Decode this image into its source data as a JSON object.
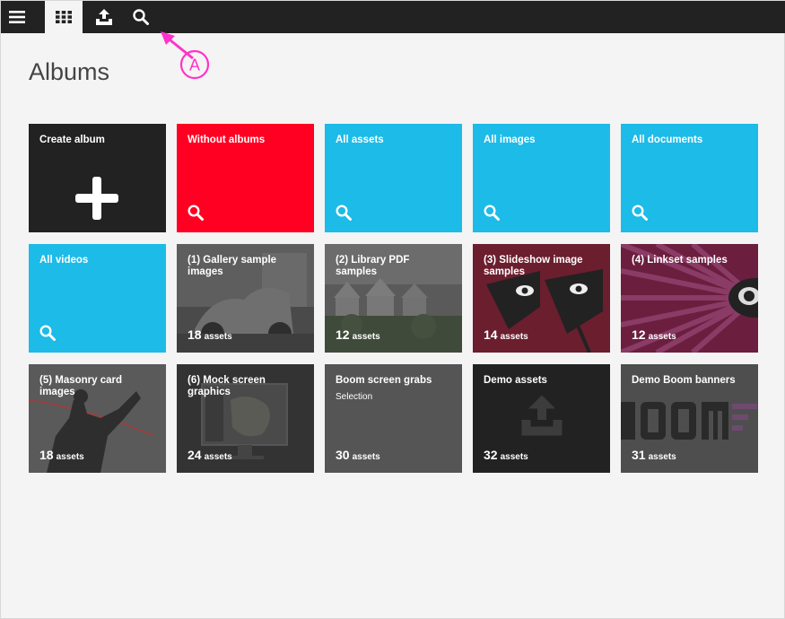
{
  "colors": {
    "topbar": "#222222",
    "dark_tile": "#222222",
    "red_tile": "#ff0022",
    "blue_tile": "#1dbbe8",
    "grey_tile": "#555555",
    "annotation": "#ff33cc"
  },
  "toolbar": {
    "menu_icon": "hamburger-icon",
    "grid_icon": "grid-icon",
    "upload_icon": "upload-icon",
    "search_icon": "search-icon"
  },
  "page": {
    "title": "Albums"
  },
  "annotation": {
    "label": "A"
  },
  "tiles": [
    {
      "title": "Create album"
    },
    {
      "title": "Without albums"
    },
    {
      "title": "All assets"
    },
    {
      "title": "All images"
    },
    {
      "title": "All documents"
    },
    {
      "title": "All videos"
    },
    {
      "title": "(1) Gallery sample images",
      "count": "18",
      "unit": "assets"
    },
    {
      "title": "(2) Library PDF samples",
      "count": "12",
      "unit": "assets"
    },
    {
      "title": "(3) Slideshow image samples",
      "count": "14",
      "unit": "assets"
    },
    {
      "title": "(4) Linkset samples",
      "count": "12",
      "unit": "assets"
    },
    {
      "title": "(5) Masonry card images",
      "count": "18",
      "unit": "assets"
    },
    {
      "title": "(6) Mock screen graphics",
      "count": "24",
      "unit": "assets"
    },
    {
      "title": "Boom screen grabs",
      "subtitle": "Selection",
      "count": "30",
      "unit": "assets"
    },
    {
      "title": "Demo assets",
      "count": "32",
      "unit": "assets"
    },
    {
      "title": "Demo Boom banners",
      "count": "31",
      "unit": "assets"
    }
  ]
}
